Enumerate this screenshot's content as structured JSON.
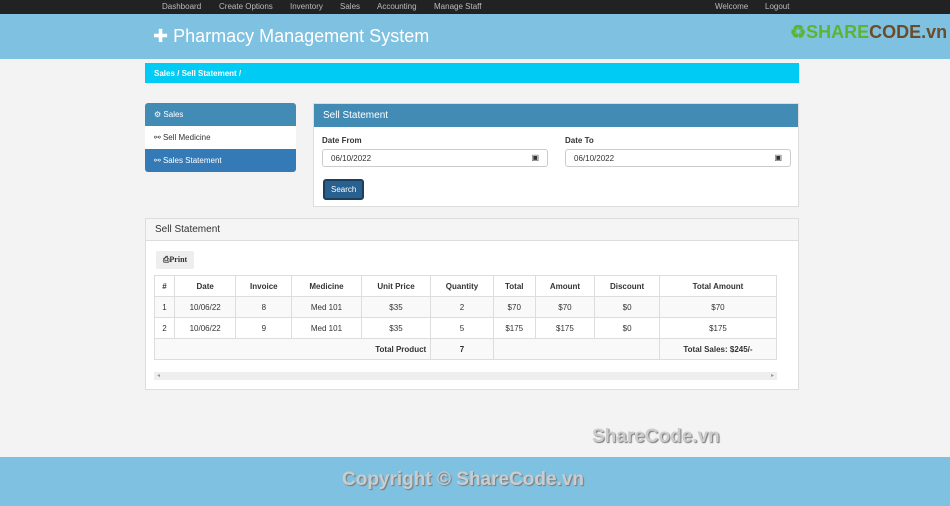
{
  "nav": {
    "items": [
      "Dashboard",
      "Create Options",
      "Inventory",
      "Sales",
      "Accounting",
      "Manage Staff"
    ],
    "welcome": "Welcome",
    "logout": "Logout"
  },
  "header": {
    "title": "Pharmacy Management System",
    "logo_a": "SHARE",
    "logo_b": "CODE.vn"
  },
  "breadcrumb": "Sales / Sell Statement  /",
  "sidebar": {
    "heading": "Sales",
    "items": [
      "Sell Medicine",
      "Sales Statement"
    ]
  },
  "filter": {
    "title": "Sell Statement",
    "from_label": "Date From",
    "from_value": "06/10/2022",
    "to_label": "Date To",
    "to_value": "06/10/2022",
    "search": "Search"
  },
  "statement": {
    "title": "Sell Statement",
    "print": "Print",
    "columns": [
      "#",
      "Date",
      "Invoice",
      "Medicine",
      "Unit Price",
      "Quantity",
      "Total",
      "Amount",
      "Discount",
      "Total Amount"
    ],
    "rows": [
      [
        "1",
        "10/06/22",
        "8",
        "Med 101",
        "$35",
        "2",
        "$70",
        "$70",
        "$0",
        "$70"
      ],
      [
        "2",
        "10/06/22",
        "9",
        "Med 101",
        "$35",
        "5",
        "$175",
        "$175",
        "$0",
        "$175"
      ]
    ],
    "total_product_label": "Total Product",
    "total_product": "7",
    "total_sales": "Total Sales: $245/-"
  },
  "watermark": "ShareCode.vn",
  "copyright": "Copyright © ShareCode.vn"
}
